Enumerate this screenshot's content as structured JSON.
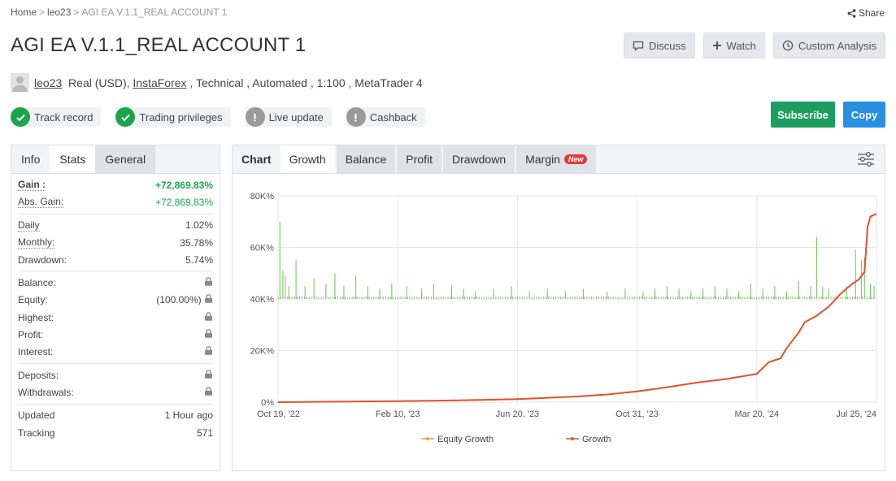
{
  "breadcrumb": {
    "home": "Home",
    "user": "leo23",
    "current": "AGI EA V.1.1_REAL ACCOUNT 1",
    "sep": ">"
  },
  "share_label": "Share",
  "title": "AGI EA V.1.1_REAL ACCOUNT 1",
  "top_buttons": {
    "discuss": "Discuss",
    "watch": "Watch",
    "custom_analysis": "Custom Analysis"
  },
  "owner": {
    "username": "leo23",
    "account_type": "Real (USD),",
    "broker": "InstaForex",
    "details": ", Technical , Automated , 1:100 , MetaTrader 4"
  },
  "badges": [
    {
      "label": "Track record",
      "status": "ok"
    },
    {
      "label": "Trading privileges",
      "status": "ok"
    },
    {
      "label": "Live update",
      "status": "warn"
    },
    {
      "label": "Cashback",
      "status": "warn"
    }
  ],
  "actions": {
    "subscribe": "Subscribe",
    "copy": "Copy"
  },
  "left_tabs": [
    "Info",
    "Stats",
    "General"
  ],
  "stats": {
    "gain": {
      "label": "Gain :",
      "value": "+72,869.83%"
    },
    "abs_gain": {
      "label": "Abs. Gain:",
      "value": "+72,869.83%"
    },
    "daily": {
      "label": "Daily",
      "value": "1.02%"
    },
    "monthly": {
      "label": "Monthly:",
      "value": "35.78%"
    },
    "drawdown": {
      "label": "Drawdown:",
      "value": "5.74%"
    },
    "balance": {
      "label": "Balance:"
    },
    "equity": {
      "label": "Equity:",
      "value": "(100.00%)"
    },
    "highest": {
      "label": "Highest:"
    },
    "profit": {
      "label": "Profit:"
    },
    "interest": {
      "label": "Interest:"
    },
    "deposits": {
      "label": "Deposits:"
    },
    "withdrawals": {
      "label": "Withdrawals:"
    },
    "updated": {
      "label": "Updated",
      "value": "1 Hour ago"
    },
    "tracking": {
      "label": "Tracking",
      "value": "571"
    }
  },
  "chart_tabs": {
    "chart": "Chart",
    "growth": "Growth",
    "balance": "Balance",
    "profit": "Profit",
    "drawdown": "Drawdown",
    "margin": "Margin",
    "new_badge": "New"
  },
  "colors": {
    "growth_line": "#e0522b",
    "equity_line": "#f0a04b",
    "bars": "#6fbf5a",
    "accent_green": "#1aa54d",
    "accent_blue": "#2a8fe0"
  },
  "chart_data": {
    "type": "line",
    "title": "",
    "xlabel": "",
    "ylabel": "",
    "y_ticks": [
      "0%",
      "20K%",
      "40K%",
      "60K%",
      "80K%"
    ],
    "ylim": [
      0,
      80000
    ],
    "x_ticks": [
      "Oct 19, '22",
      "Feb 10, '23",
      "Jun 20, '23",
      "Oct 31, '23",
      "Mar 20, '24",
      "Jul 25, '24"
    ],
    "grid": true,
    "legend": {
      "position": "bottom",
      "entries": [
        "Equity Growth",
        "Growth"
      ]
    },
    "series": [
      {
        "name": "Growth",
        "points": [
          [
            0,
            0
          ],
          [
            0.1,
            200
          ],
          [
            0.2,
            400
          ],
          [
            0.3,
            700
          ],
          [
            0.4,
            1200
          ],
          [
            0.5,
            2200
          ],
          [
            0.55,
            3000
          ],
          [
            0.6,
            4200
          ],
          [
            0.65,
            5800
          ],
          [
            0.7,
            7600
          ],
          [
            0.75,
            9000
          ],
          [
            0.8,
            11000
          ],
          [
            0.82,
            15500
          ],
          [
            0.84,
            17000
          ],
          [
            0.85,
            21000
          ],
          [
            0.87,
            27000
          ],
          [
            0.88,
            31000
          ],
          [
            0.9,
            33500
          ],
          [
            0.92,
            37000
          ],
          [
            0.94,
            42000
          ],
          [
            0.96,
            46000
          ],
          [
            0.97,
            47500
          ],
          [
            0.98,
            50500
          ],
          [
            0.985,
            68000
          ],
          [
            0.99,
            72000
          ],
          [
            1.0,
            73000
          ]
        ]
      },
      {
        "name": "Equity Growth",
        "points": [
          [
            0,
            0
          ],
          [
            0.1,
            200
          ],
          [
            0.2,
            400
          ],
          [
            0.3,
            700
          ],
          [
            0.4,
            1200
          ],
          [
            0.5,
            2200
          ],
          [
            0.55,
            3000
          ],
          [
            0.6,
            4200
          ],
          [
            0.65,
            5800
          ],
          [
            0.7,
            7600
          ],
          [
            0.75,
            9000
          ],
          [
            0.8,
            11000
          ],
          [
            0.82,
            15500
          ],
          [
            0.84,
            17000
          ],
          [
            0.85,
            21000
          ],
          [
            0.87,
            27000
          ],
          [
            0.88,
            31000
          ],
          [
            0.9,
            33500
          ],
          [
            0.92,
            37000
          ],
          [
            0.94,
            42000
          ],
          [
            0.96,
            46000
          ],
          [
            0.97,
            47500
          ],
          [
            0.98,
            50500
          ],
          [
            0.985,
            68000
          ],
          [
            0.99,
            72000
          ],
          [
            1.0,
            73000
          ]
        ]
      }
    ],
    "bars_baseline": 40000,
    "bars": [
      [
        0.003,
        70000
      ],
      [
        0.008,
        51000
      ],
      [
        0.012,
        49000
      ],
      [
        0.018,
        45000
      ],
      [
        0.03,
        55000
      ],
      [
        0.045,
        45000
      ],
      [
        0.06,
        48000
      ],
      [
        0.08,
        46000
      ],
      [
        0.095,
        50000
      ],
      [
        0.11,
        45000
      ],
      [
        0.13,
        49000
      ],
      [
        0.15,
        45000
      ],
      [
        0.17,
        44000
      ],
      [
        0.19,
        46000
      ],
      [
        0.215,
        45000
      ],
      [
        0.24,
        44000
      ],
      [
        0.26,
        46000
      ],
      [
        0.29,
        45000
      ],
      [
        0.31,
        44000
      ],
      [
        0.33,
        43000
      ],
      [
        0.36,
        44000
      ],
      [
        0.39,
        45000
      ],
      [
        0.42,
        43000
      ],
      [
        0.45,
        44000
      ],
      [
        0.48,
        43000
      ],
      [
        0.51,
        44000
      ],
      [
        0.55,
        43000
      ],
      [
        0.58,
        44000
      ],
      [
        0.61,
        43000
      ],
      [
        0.63,
        44000
      ],
      [
        0.65,
        45000
      ],
      [
        0.67,
        44000
      ],
      [
        0.69,
        43000
      ],
      [
        0.71,
        44000
      ],
      [
        0.73,
        45000
      ],
      [
        0.75,
        44000
      ],
      [
        0.77,
        43000
      ],
      [
        0.79,
        46000
      ],
      [
        0.81,
        44000
      ],
      [
        0.83,
        45000
      ],
      [
        0.85,
        43000
      ],
      [
        0.87,
        47000
      ],
      [
        0.89,
        45000
      ],
      [
        0.9,
        64000
      ],
      [
        0.91,
        45000
      ],
      [
        0.92,
        44000
      ],
      [
        0.95,
        45000
      ],
      [
        0.965,
        59000
      ],
      [
        0.975,
        55000
      ],
      [
        0.98,
        56000
      ],
      [
        0.99,
        46000
      ],
      [
        0.996,
        45000
      ]
    ]
  }
}
